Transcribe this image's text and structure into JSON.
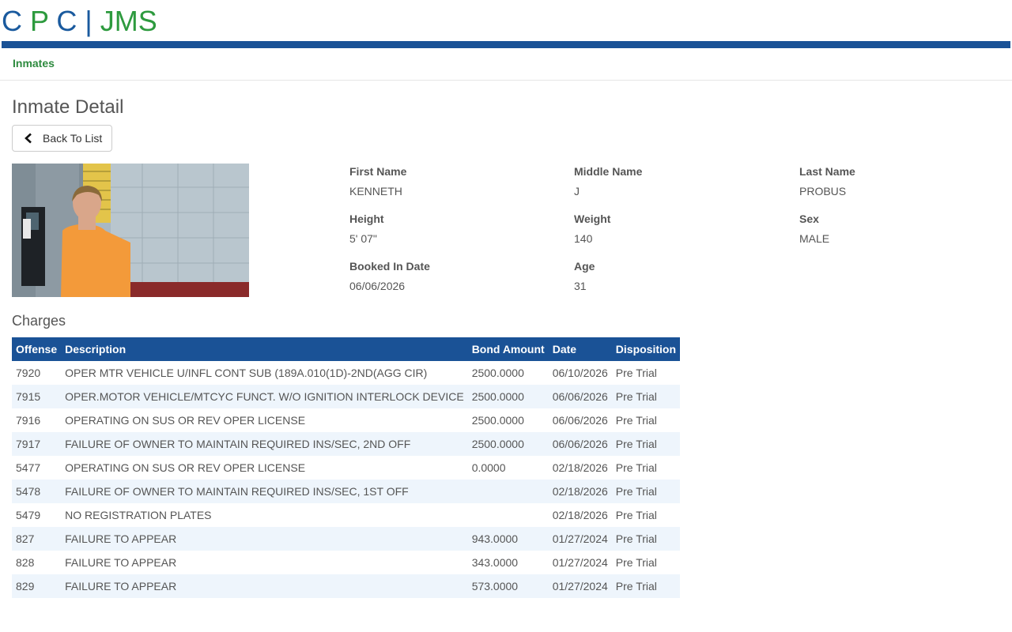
{
  "logo": {
    "c1": "C",
    "p": "P",
    "c2": "C",
    "sep": "|",
    "jms": "JMS"
  },
  "nav": {
    "inmates": "Inmates"
  },
  "page": {
    "title": "Inmate Detail",
    "back_label": "Back To List"
  },
  "inmate": {
    "first_name_label": "First Name",
    "first_name": "KENNETH",
    "middle_name_label": "Middle Name",
    "middle_name": "J",
    "last_name_label": "Last Name",
    "last_name": "PROBUS",
    "height_label": "Height",
    "height": "5' 07\"",
    "weight_label": "Weight",
    "weight": "140",
    "sex_label": "Sex",
    "sex": "MALE",
    "booked_label": "Booked In Date",
    "booked": "06/06/2026",
    "age_label": "Age",
    "age": "31"
  },
  "charges": {
    "title": "Charges",
    "headers": [
      "Offense",
      "Description",
      "Bond Amount",
      "Date",
      "Disposition"
    ],
    "rows": [
      [
        "7920",
        "OPER MTR VEHICLE U/INFL CONT SUB (189A.010(1D)-2ND(AGG CIR)",
        "2500.0000",
        "06/10/2026",
        "Pre Trial"
      ],
      [
        "7915",
        "OPER.MOTOR VEHICLE/MTCYC FUNCT. W/O IGNITION INTERLOCK DEVICE",
        "2500.0000",
        "06/06/2026",
        "Pre Trial"
      ],
      [
        "7916",
        "OPERATING ON SUS OR REV OPER LICENSE",
        "2500.0000",
        "06/06/2026",
        "Pre Trial"
      ],
      [
        "7917",
        "FAILURE OF OWNER TO MAINTAIN REQUIRED INS/SEC, 2ND OFF",
        "2500.0000",
        "06/06/2026",
        "Pre Trial"
      ],
      [
        "5477",
        "OPERATING ON SUS OR REV OPER LICENSE",
        "0.0000",
        "02/18/2026",
        "Pre Trial"
      ],
      [
        "5478",
        "FAILURE OF OWNER TO MAINTAIN REQUIRED INS/SEC, 1ST OFF",
        "",
        "02/18/2026",
        "Pre Trial"
      ],
      [
        "5479",
        "NO REGISTRATION PLATES",
        "",
        "02/18/2026",
        "Pre Trial"
      ],
      [
        "827",
        "FAILURE TO APPEAR",
        "943.0000",
        "01/27/2024",
        "Pre Trial"
      ],
      [
        "828",
        "FAILURE TO APPEAR",
        "343.0000",
        "01/27/2024",
        "Pre Trial"
      ],
      [
        "829",
        "FAILURE TO APPEAR",
        "573.0000",
        "01/27/2024",
        "Pre Trial"
      ]
    ]
  },
  "colors": {
    "brand_blue": "#1a5296",
    "brand_green": "#2d9a3e",
    "row_alt": "#eef5fc"
  },
  "icons": {
    "back": "chevron-left-icon"
  }
}
